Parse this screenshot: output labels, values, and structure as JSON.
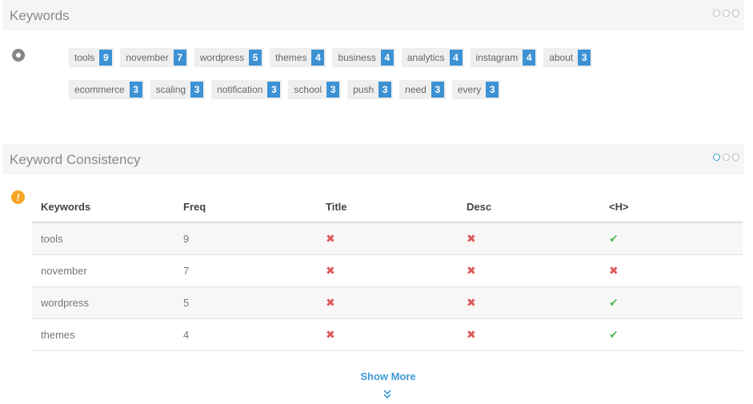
{
  "keywords_panel": {
    "title": "Keywords",
    "tags": [
      {
        "label": "tools",
        "count": "9"
      },
      {
        "label": "november",
        "count": "7"
      },
      {
        "label": "wordpress",
        "count": "5"
      },
      {
        "label": "themes",
        "count": "4"
      },
      {
        "label": "business",
        "count": "4"
      },
      {
        "label": "analytics",
        "count": "4"
      },
      {
        "label": "instagram",
        "count": "4"
      },
      {
        "label": "about",
        "count": "3"
      },
      {
        "label": "ecommerce",
        "count": "3"
      },
      {
        "label": "scaling",
        "count": "3"
      },
      {
        "label": "notification",
        "count": "3"
      },
      {
        "label": "school",
        "count": "3"
      },
      {
        "label": "push",
        "count": "3"
      },
      {
        "label": "need",
        "count": "3"
      },
      {
        "label": "every",
        "count": "3"
      }
    ]
  },
  "consistency_panel": {
    "title": "Keyword Consistency",
    "columns": [
      "Keywords",
      "Freq",
      "Title",
      "Desc",
      "<H>"
    ],
    "rows": [
      {
        "keyword": "tools",
        "freq": "9",
        "title": "✖",
        "desc": "✖",
        "h": "✔"
      },
      {
        "keyword": "november",
        "freq": "7",
        "title": "✖",
        "desc": "✖",
        "h": "✖"
      },
      {
        "keyword": "wordpress",
        "freq": "5",
        "title": "✖",
        "desc": "✖",
        "h": "✔"
      },
      {
        "keyword": "themes",
        "freq": "4",
        "title": "✖",
        "desc": "✖",
        "h": "✔"
      }
    ]
  },
  "show_more": "Show More",
  "colors": {
    "accent": "#3d92d4",
    "cross": "#e05a5a",
    "check": "#5cb85c",
    "warn": "#f5a623"
  }
}
